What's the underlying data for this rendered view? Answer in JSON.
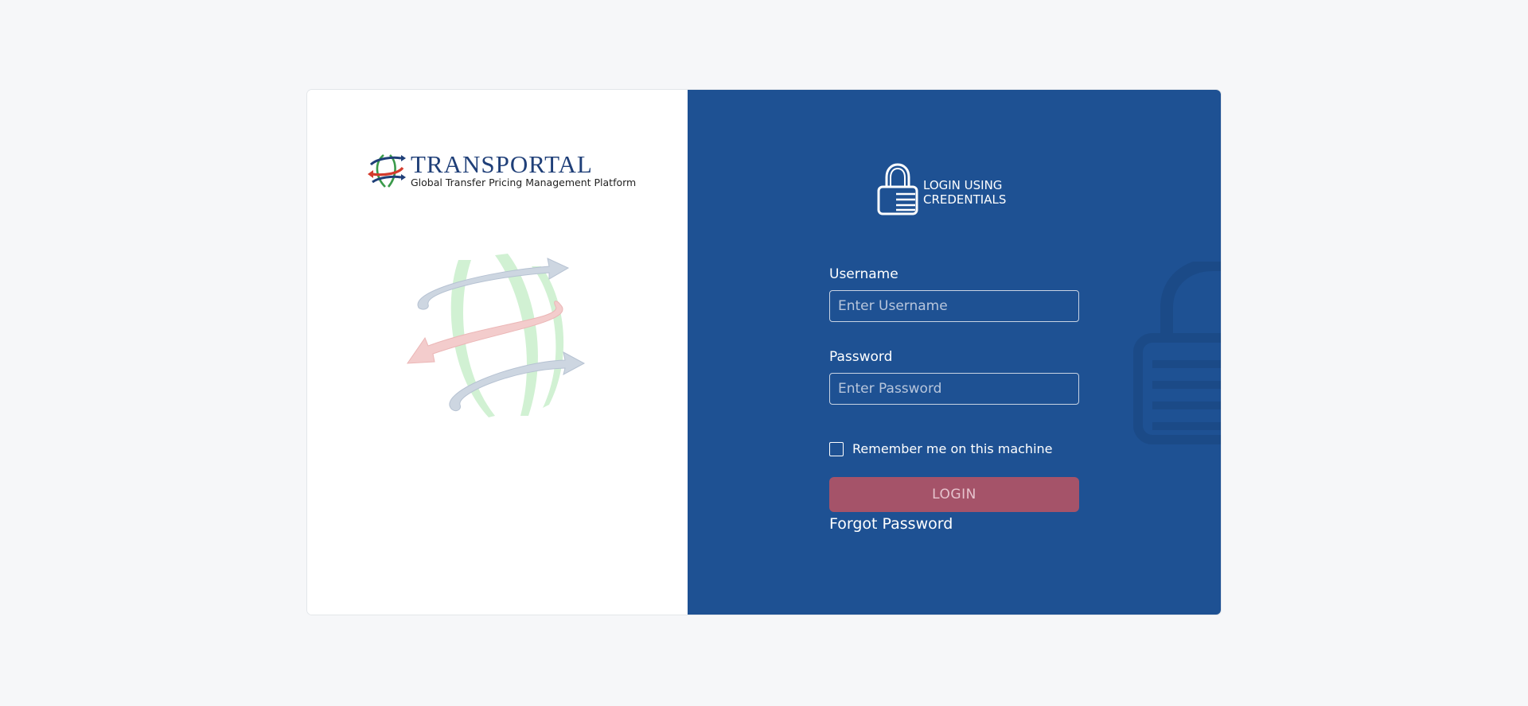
{
  "brand": {
    "name": "TRANSPORTAL",
    "tagline": "Global Transfer Pricing Management Platform",
    "logo_icon": "globe-arrows-icon"
  },
  "login": {
    "header_line1": "LOGIN USING",
    "header_line2": "CREDENTIALS",
    "header_icon": "lock-icon",
    "username_label": "Username",
    "username_placeholder": "Enter Username",
    "username_value": "",
    "password_label": "Password",
    "password_placeholder": "Enter Password",
    "password_value": "",
    "remember_label": "Remember me on this machine",
    "remember_checked": false,
    "login_button": "LOGIN",
    "forgot_password": "Forgot Password"
  },
  "colors": {
    "page_bg": "#f6f7f9",
    "panel_blue": "#1e5193",
    "login_button": "#a55369",
    "brand_navy": "#1f3f78"
  }
}
